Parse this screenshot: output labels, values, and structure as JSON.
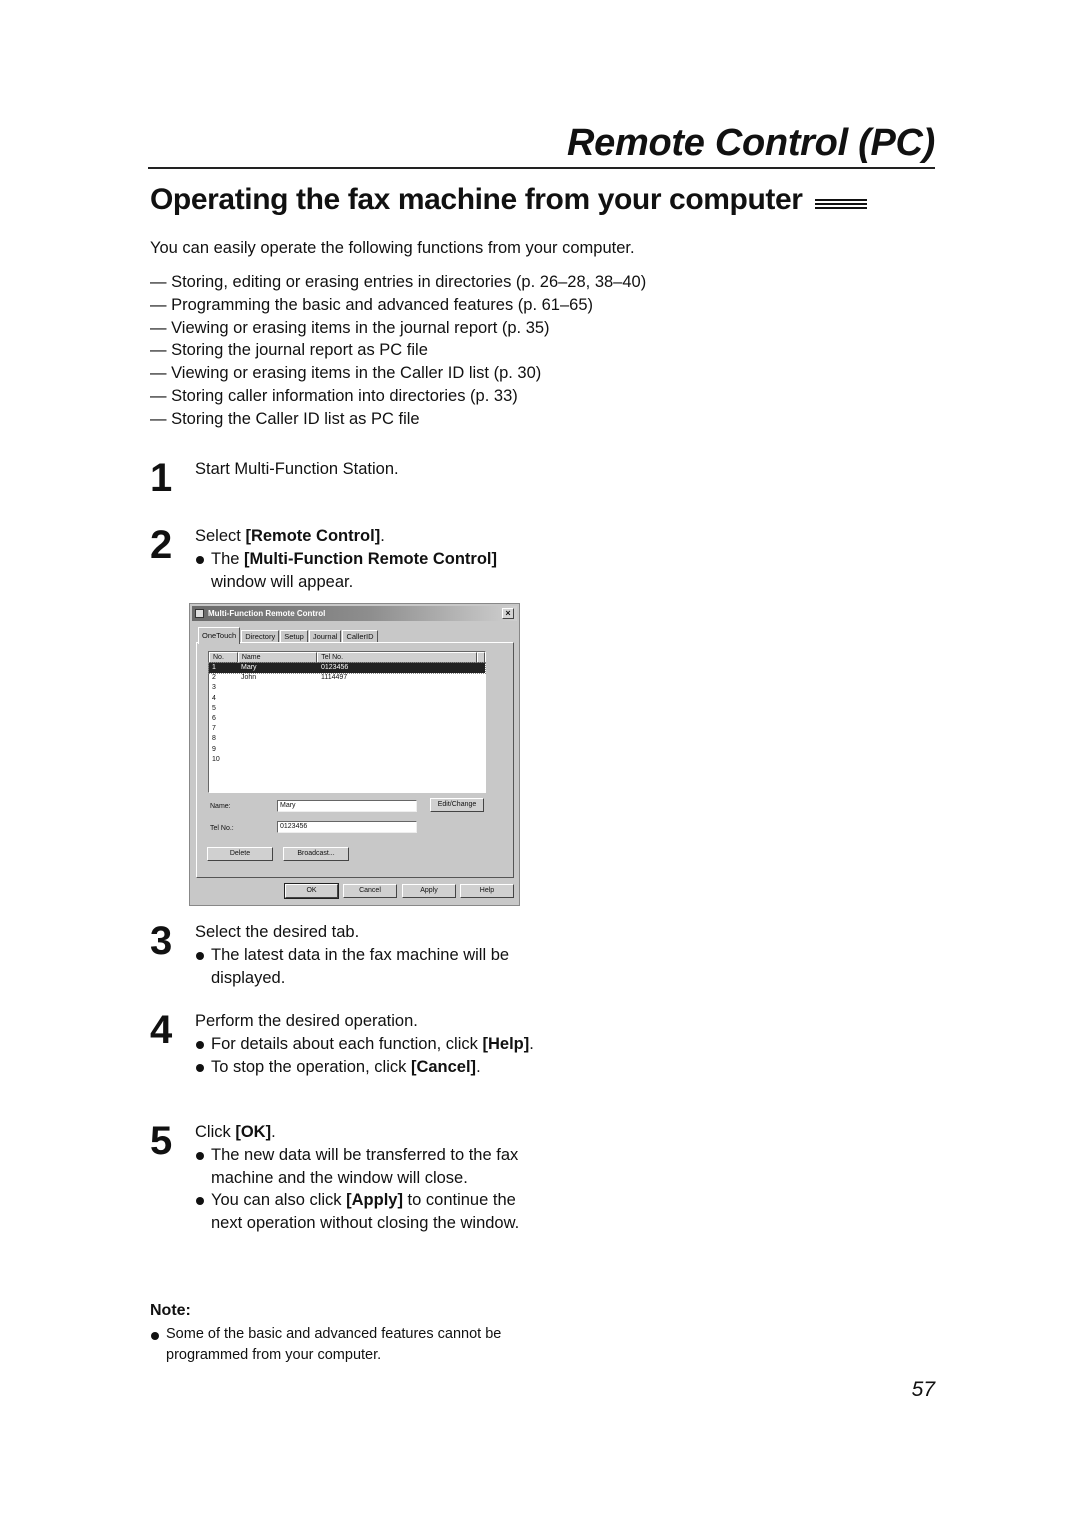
{
  "header": {
    "section_title": "Remote Control (PC)",
    "page_heading": "Operating the fax machine from your computer"
  },
  "intro": "You can easily operate the following functions from your computer.",
  "functions": [
    "— Storing, editing or erasing entries in directories (p. 26–28, 38–40)",
    "— Programming the basic and advanced features (p. 61–65)",
    "— Viewing or erasing items in the journal report (p. 35)",
    "— Storing the journal report as PC file",
    "— Viewing or erasing items in the Caller ID list (p. 30)",
    "— Storing caller information into directories (p. 33)",
    "— Storing the Caller ID list as PC file"
  ],
  "steps": {
    "s1": {
      "num": "1",
      "text": "Start Multi-Function Station."
    },
    "s2": {
      "num": "2",
      "pre": "Select ",
      "bold": "[Remote Control]",
      "post": ".",
      "bullet_pre": "The ",
      "bullet_bold": "[Multi-Function Remote Control]",
      "bullet_post": " window will appear."
    },
    "s3": {
      "num": "3",
      "text": "Select the desired tab.",
      "bullet": "The latest data in the fax machine will be displayed."
    },
    "s4": {
      "num": "4",
      "text": "Perform the desired operation.",
      "bullet1_pre": "For details about each function, click ",
      "bullet1_bold": "[Help]",
      "bullet1_post": ".",
      "bullet2_pre": "To stop the operation, click ",
      "bullet2_bold": "[Cancel]",
      "bullet2_post": "."
    },
    "s5": {
      "num": "5",
      "pre": "Click ",
      "bold": "[OK]",
      "post": ".",
      "bullet1": "The new data will be transferred to the fax machine and the window will close.",
      "bullet2_pre": "You can also click ",
      "bullet2_bold": "[Apply]",
      "bullet2_post": " to continue the next operation without closing the window."
    }
  },
  "dialog": {
    "title": "Multi-Function Remote Control",
    "close": "×",
    "tabs": [
      "OneTouch",
      "Directory",
      "Setup",
      "Journal",
      "CallerID"
    ],
    "columns": [
      "No.",
      "Name",
      "Tel No."
    ],
    "rows": [
      {
        "no": "1",
        "name": "Mary",
        "tel": "0123456",
        "selected": true
      },
      {
        "no": "2",
        "name": "John",
        "tel": "1114497"
      },
      {
        "no": "3",
        "name": "",
        "tel": ""
      },
      {
        "no": "4",
        "name": "",
        "tel": ""
      },
      {
        "no": "5",
        "name": "",
        "tel": ""
      },
      {
        "no": "6",
        "name": "",
        "tel": ""
      },
      {
        "no": "7",
        "name": "",
        "tel": ""
      },
      {
        "no": "8",
        "name": "",
        "tel": ""
      },
      {
        "no": "9",
        "name": "",
        "tel": ""
      },
      {
        "no": "10",
        "name": "",
        "tel": ""
      }
    ],
    "name_label": "Name:",
    "name_value": "Mary",
    "tel_label": "Tel No.:",
    "tel_value": "0123456",
    "edit_button": "Edit/Change",
    "delete_button": "Delete",
    "broadcast_button": "Broadcast...",
    "ok_button": "OK",
    "cancel_button": "Cancel",
    "apply_button": "Apply",
    "help_button": "Help"
  },
  "note": {
    "label": "Note:",
    "text": "Some of the basic and advanced features cannot be programmed from your computer."
  },
  "page_number": "57"
}
